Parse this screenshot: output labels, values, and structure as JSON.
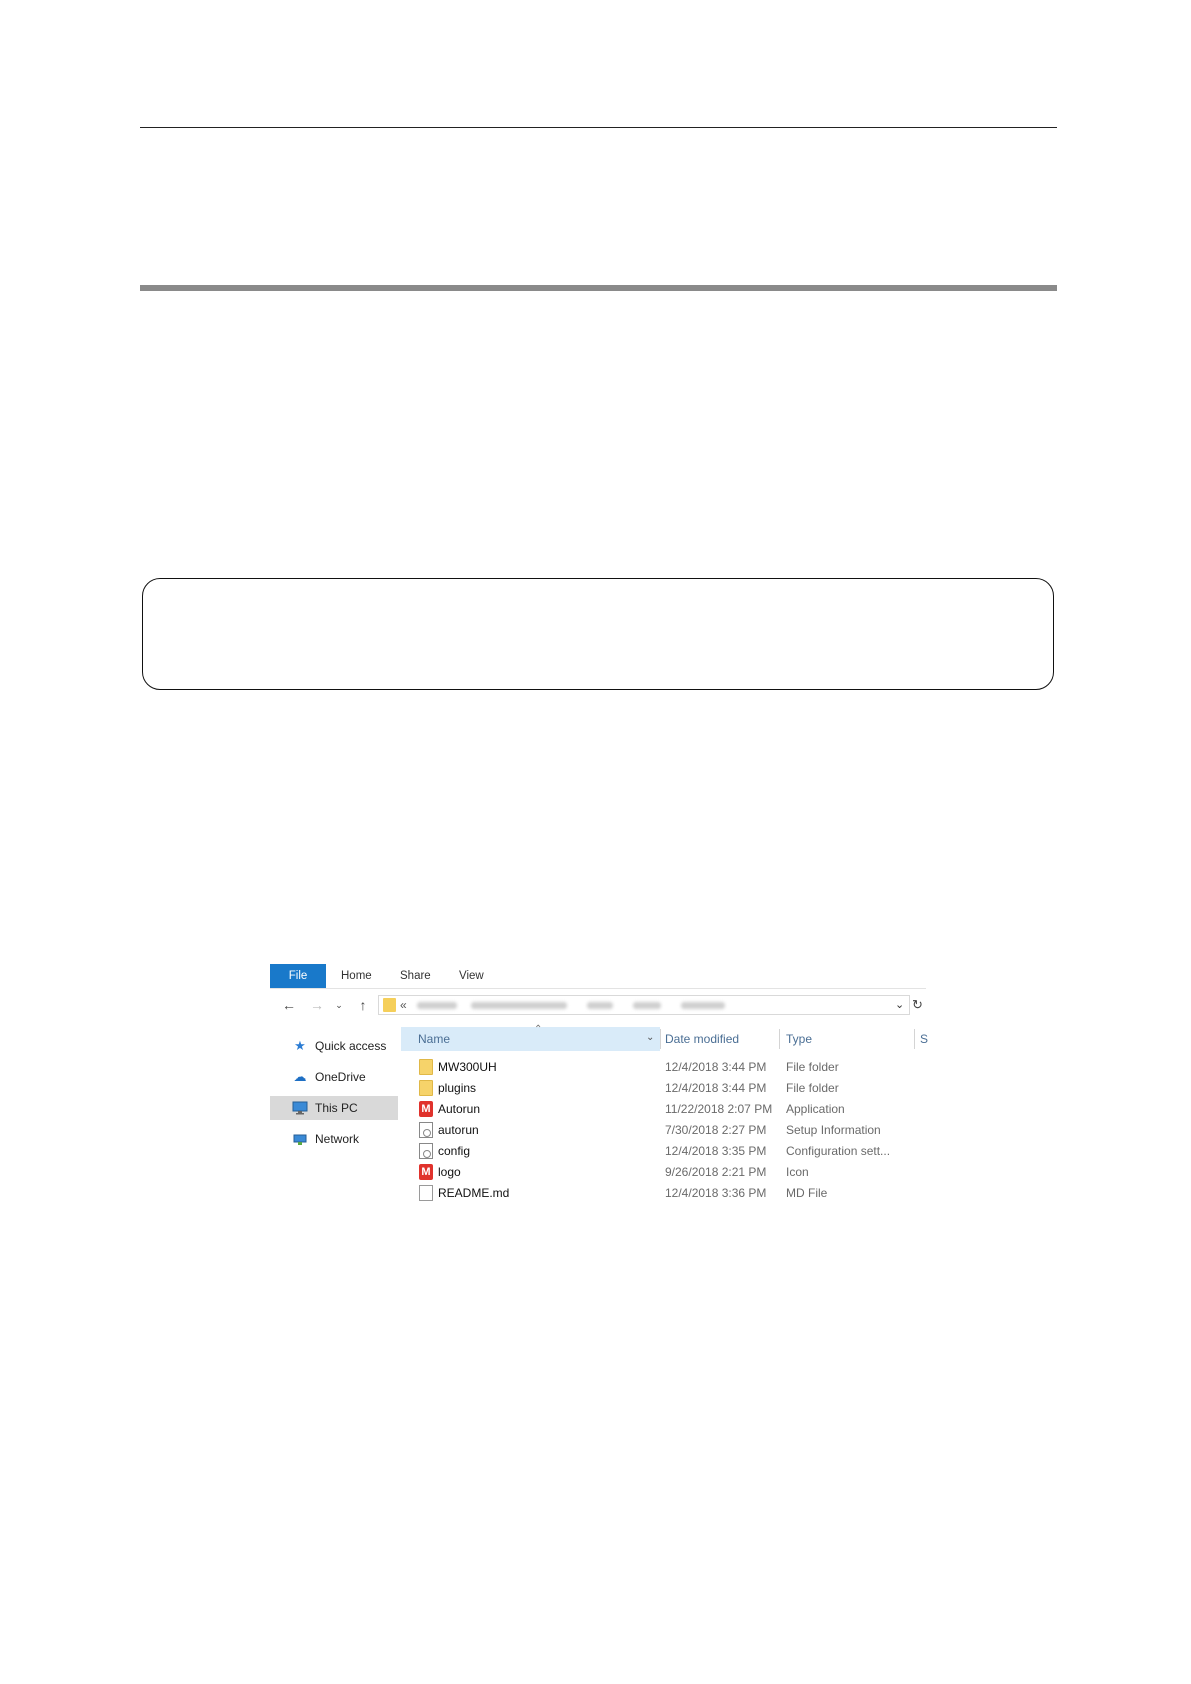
{
  "ribbon": {
    "tabs": [
      "File",
      "Home",
      "Share",
      "View"
    ]
  },
  "address": {
    "prefix": "«"
  },
  "nav_pane": [
    {
      "label": "Quick access",
      "icon": "star-icon"
    },
    {
      "label": "OneDrive",
      "icon": "cloud-icon"
    },
    {
      "label": "This PC",
      "icon": "computer-icon",
      "selected": true
    },
    {
      "label": "Network",
      "icon": "network-icon"
    }
  ],
  "columns": {
    "name": "Name",
    "date": "Date modified",
    "type": "Type",
    "size": "S"
  },
  "files": [
    {
      "name": "MW300UH",
      "date": "12/4/2018 3:44 PM",
      "type": "File folder",
      "icon": "folder-icon"
    },
    {
      "name": "plugins",
      "date": "12/4/2018 3:44 PM",
      "type": "File folder",
      "icon": "folder-icon"
    },
    {
      "name": "Autorun",
      "date": "11/22/2018 2:07 PM",
      "type": "Application",
      "icon": "app-icon"
    },
    {
      "name": "autorun",
      "date": "7/30/2018 2:27 PM",
      "type": "Setup Information",
      "icon": "setup-icon"
    },
    {
      "name": "config",
      "date": "12/4/2018 3:35 PM",
      "type": "Configuration sett...",
      "icon": "config-icon"
    },
    {
      "name": "logo",
      "date": "9/26/2018 2:21 PM",
      "type": "Icon",
      "icon": "app-icon"
    },
    {
      "name": "README.md",
      "date": "12/4/2018 3:36 PM",
      "type": "MD File",
      "icon": "document-icon"
    }
  ],
  "colors": {
    "file_tab": "#1979ca",
    "header_selected": "#d9ebf9",
    "folder": "#f6d36a",
    "app_icon": "#e0322c"
  }
}
